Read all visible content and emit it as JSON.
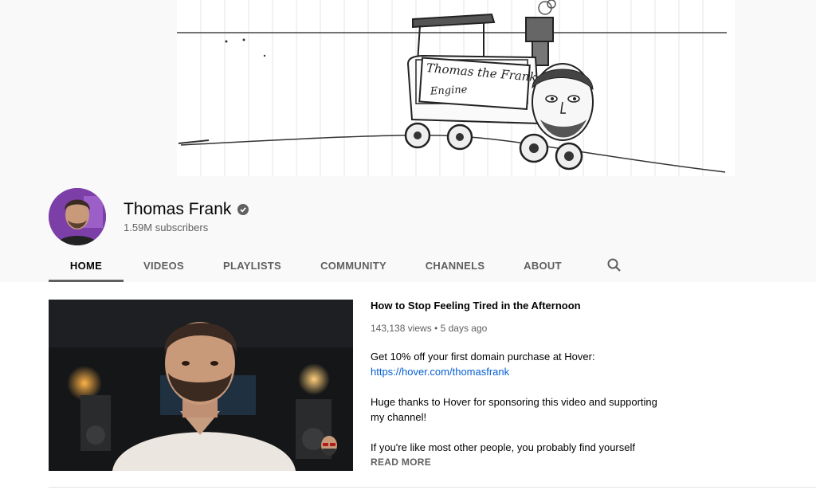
{
  "banner": {
    "art_text_line1": "Thomas the Frank",
    "art_text_line2": "Engine"
  },
  "channel": {
    "name": "Thomas Frank",
    "subscribers": "1.59M subscribers"
  },
  "tabs": [
    {
      "label": "HOME",
      "active": true
    },
    {
      "label": "VIDEOS"
    },
    {
      "label": "PLAYLISTS"
    },
    {
      "label": "COMMUNITY"
    },
    {
      "label": "CHANNELS"
    },
    {
      "label": "ABOUT"
    }
  ],
  "featured": {
    "title": "How to Stop Feeling Tired in the Afternoon",
    "meta": "143,138 views • 5 days ago",
    "desc_line1": "Get 10% off your first domain purchase at Hover:",
    "desc_link": "https://hover.com/thomasfrank",
    "desc_para2": "Huge thanks to Hover for sponsoring this video and supporting my channel!",
    "desc_para3": "If you're like most other people, you probably find yourself",
    "read_more": "READ MORE"
  },
  "colors": {
    "accent_link": "#065fd4",
    "avatar_bg": "#7c3fa8"
  },
  "icons": [
    "verified-check-icon",
    "search-icon"
  ]
}
